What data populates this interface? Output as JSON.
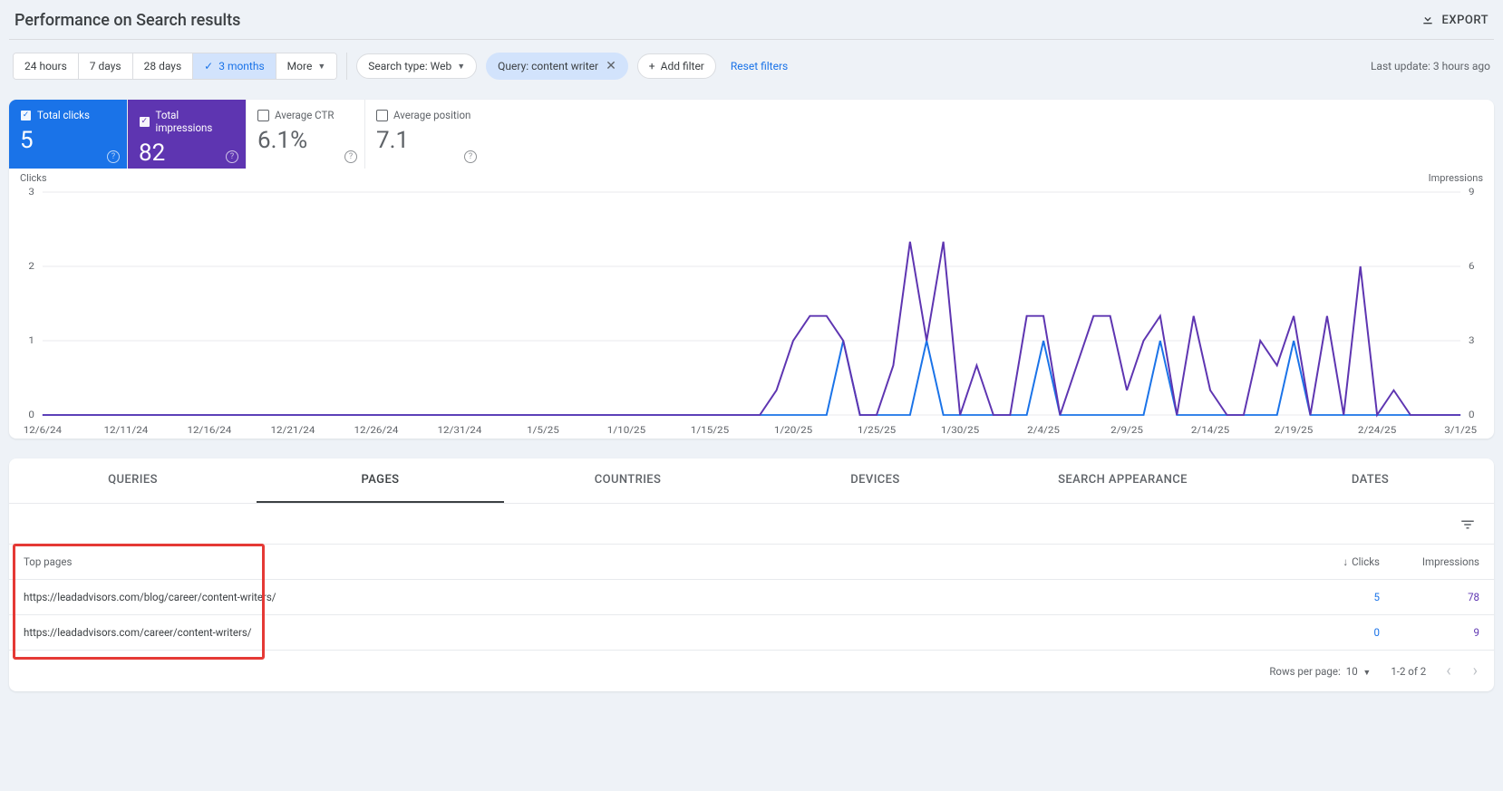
{
  "header": {
    "title": "Performance on Search results",
    "export_label": "EXPORT"
  },
  "date_range": {
    "options": [
      "24 hours",
      "7 days",
      "28 days",
      "3 months",
      "More"
    ],
    "active": "3 months"
  },
  "filters": {
    "search_type": "Search type: Web",
    "query_chip": "Query: content writer",
    "add_filter": "Add filter",
    "reset": "Reset filters",
    "last_update": "Last update: 3 hours ago"
  },
  "metrics": {
    "clicks": {
      "label": "Total clicks",
      "value": "5"
    },
    "impressions": {
      "label": "Total impressions",
      "value": "82"
    },
    "ctr": {
      "label": "Average CTR",
      "value": "6.1%"
    },
    "position": {
      "label": "Average position",
      "value": "7.1"
    }
  },
  "chart_data": {
    "type": "line",
    "left_axis_label": "Clicks",
    "right_axis_label": "Impressions",
    "y_left": [
      0,
      1,
      2,
      3
    ],
    "y_right": [
      0,
      3,
      6,
      9
    ],
    "x_labels": [
      "12/6/24",
      "12/11/24",
      "12/16/24",
      "12/21/24",
      "12/26/24",
      "12/31/24",
      "1/5/25",
      "1/10/25",
      "1/15/25",
      "1/20/25",
      "1/25/25",
      "1/30/25",
      "2/4/25",
      "2/9/25",
      "2/14/25",
      "2/19/25",
      "2/24/25",
      "3/1/25"
    ],
    "series": [
      {
        "name": "Clicks",
        "axis": "left",
        "color": "#1a73e8",
        "values": [
          0,
          0,
          0,
          0,
          0,
          0,
          0,
          0,
          0,
          0,
          0,
          0,
          0,
          0,
          0,
          0,
          0,
          0,
          0,
          0,
          0,
          0,
          0,
          0,
          0,
          0,
          0,
          0,
          0,
          0,
          0,
          0,
          0,
          0,
          0,
          0,
          0,
          0,
          0,
          0,
          0,
          0,
          0,
          0,
          0,
          0,
          0,
          0,
          1,
          0,
          0,
          0,
          0,
          1,
          0,
          0,
          0,
          0,
          0,
          0,
          1,
          0,
          0,
          0,
          0,
          0,
          0,
          1,
          0,
          0,
          0,
          0,
          0,
          0,
          0,
          1,
          0,
          0,
          0,
          0,
          0,
          0,
          0,
          0,
          0,
          0
        ]
      },
      {
        "name": "Impressions",
        "axis": "right",
        "color": "#5e35b1",
        "values": [
          0,
          0,
          0,
          0,
          0,
          0,
          0,
          0,
          0,
          0,
          0,
          0,
          0,
          0,
          0,
          0,
          0,
          0,
          0,
          0,
          0,
          0,
          0,
          0,
          0,
          0,
          0,
          0,
          0,
          0,
          0,
          0,
          0,
          0,
          0,
          0,
          0,
          0,
          0,
          0,
          0,
          0,
          0,
          0,
          1,
          3,
          4,
          4,
          3,
          0,
          0,
          2,
          7,
          3,
          7,
          0,
          2,
          0,
          0,
          4,
          4,
          0,
          2,
          4,
          4,
          1,
          3,
          4,
          0,
          4,
          1,
          0,
          0,
          3,
          2,
          4,
          0,
          4,
          0,
          6,
          0,
          1,
          0,
          0,
          0,
          0
        ]
      }
    ]
  },
  "tabs": [
    "QUERIES",
    "PAGES",
    "COUNTRIES",
    "DEVICES",
    "SEARCH APPEARANCE",
    "DATES"
  ],
  "active_tab": "PAGES",
  "table": {
    "col_page": "Top pages",
    "col_clicks": "Clicks",
    "col_impr": "Impressions",
    "rows": [
      {
        "url": "https://leadadvisors.com/blog/career/content-writers/",
        "clicks": "5",
        "impressions": "78"
      },
      {
        "url": "https://leadadvisors.com/career/content-writers/",
        "clicks": "0",
        "impressions": "9"
      }
    ]
  },
  "pager": {
    "rpp_label": "Rows per page:",
    "rpp_value": "10",
    "range": "1-2 of 2"
  }
}
